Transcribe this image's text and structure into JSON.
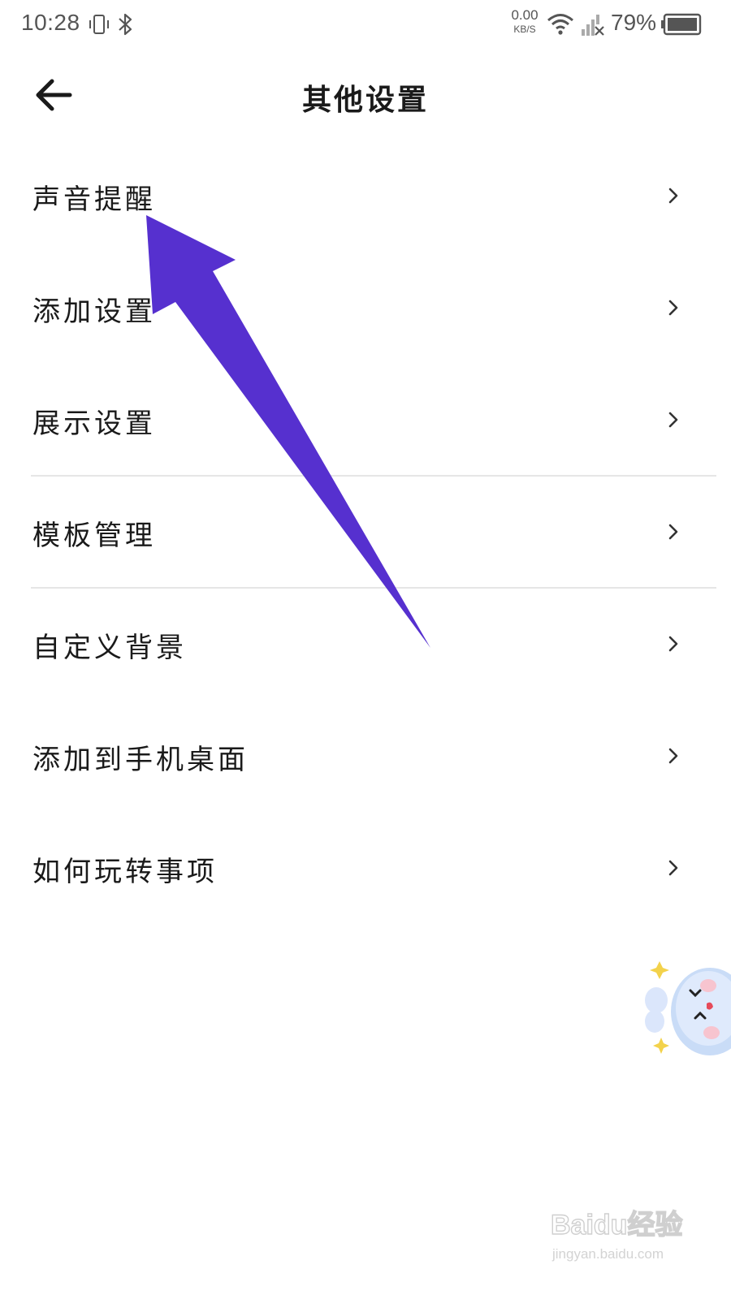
{
  "status_bar": {
    "time": "10:28",
    "net_speed_value": "0.00",
    "net_speed_unit": "KB/S",
    "battery_percent": "79%"
  },
  "header": {
    "title": "其他设置",
    "back_icon": "arrow-left-icon"
  },
  "menu": {
    "items": [
      {
        "label": "声音提醒"
      },
      {
        "label": "添加设置"
      },
      {
        "label": "展示设置"
      },
      {
        "label": "模板管理"
      },
      {
        "label": "自定义背景"
      },
      {
        "label": "添加到手机桌面"
      },
      {
        "label": "如何玩转事项"
      }
    ],
    "chevron_icon": "chevron-right-icon"
  },
  "annotation": {
    "color": "#5630cf",
    "icon": "pointer-arrow"
  },
  "mascot_icon": "cartoon-mascot-icon",
  "watermark": {
    "brand": "Baidu经验",
    "url": "jingyan.baidu.com"
  },
  "colors": {
    "text": "#1a1a1a",
    "status_text": "#555555",
    "divider": "#e6e6e6",
    "annotation_arrow": "#5630cf"
  }
}
